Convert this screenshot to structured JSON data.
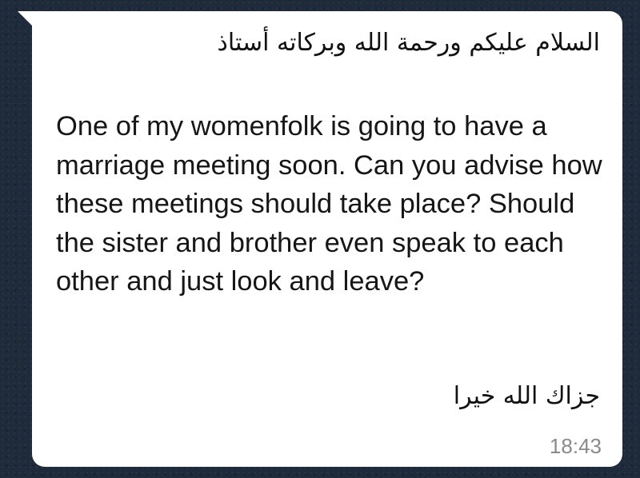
{
  "message": {
    "greeting": "السلام عليكم ورحمة الله وبركاته أستاذ",
    "body": "One of my womenfolk is going to have a marriage meeting soon. Can you advise how these meetings should take place? Should the sister and brother even speak to each other and just look and leave?",
    "closing": "جزاك الله خيرا",
    "time": "18:43"
  },
  "colors": {
    "chat_background": "#1f2a3a",
    "bubble": "#ffffff",
    "timestamp": "#8a8a8a"
  }
}
